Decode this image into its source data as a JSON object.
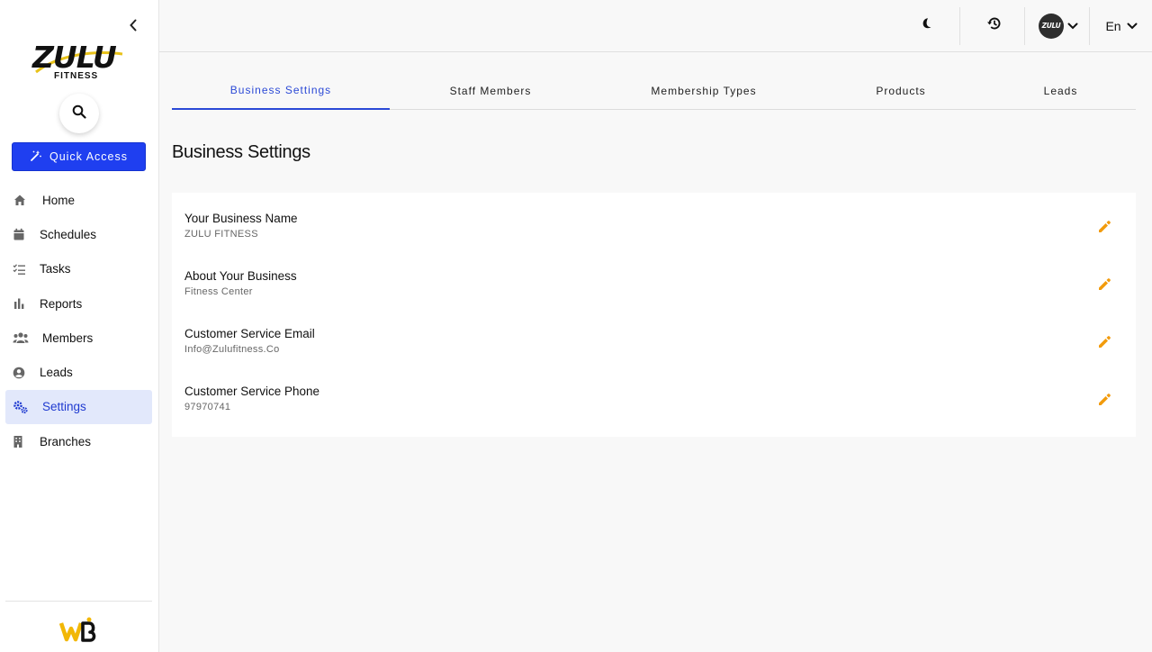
{
  "app": {
    "brand_main": "ZULU",
    "brand_sub": "FITNESS"
  },
  "sidebar": {
    "quick_access_label": "Quick Access",
    "items": [
      {
        "label": "Home",
        "icon": "home-icon"
      },
      {
        "label": "Schedules",
        "icon": "calendar-icon"
      },
      {
        "label": "Tasks",
        "icon": "checklist-icon"
      },
      {
        "label": "Reports",
        "icon": "bar-chart-icon"
      },
      {
        "label": "Members",
        "icon": "group-icon"
      },
      {
        "label": "Leads",
        "icon": "account-circle-icon"
      },
      {
        "label": "Settings",
        "icon": "gears-icon",
        "active": true
      },
      {
        "label": "Branches",
        "icon": "building-icon"
      }
    ]
  },
  "topbar": {
    "avatar_text": "ZULU",
    "language": "En"
  },
  "tabs": [
    {
      "label": "Business Settings",
      "active": true
    },
    {
      "label": "Staff Members"
    },
    {
      "label": "Membership Types"
    },
    {
      "label": "Products"
    },
    {
      "label": "Leads"
    }
  ],
  "page": {
    "title": "Business Settings"
  },
  "settings": [
    {
      "label": "Your Business Name",
      "value": "ZULU FITNESS"
    },
    {
      "label": "About Your Business",
      "value": "Fitness Center"
    },
    {
      "label": "Customer Service Email",
      "value": "Info@Zulufitness.Co"
    },
    {
      "label": "Customer Service Phone",
      "value": "97970741"
    }
  ],
  "colors": {
    "accent": "#1f3ff0",
    "active_tab": "#2b49d6",
    "edit_icon": "#f29b0c",
    "active_nav_bg": "#e2e8fb"
  }
}
